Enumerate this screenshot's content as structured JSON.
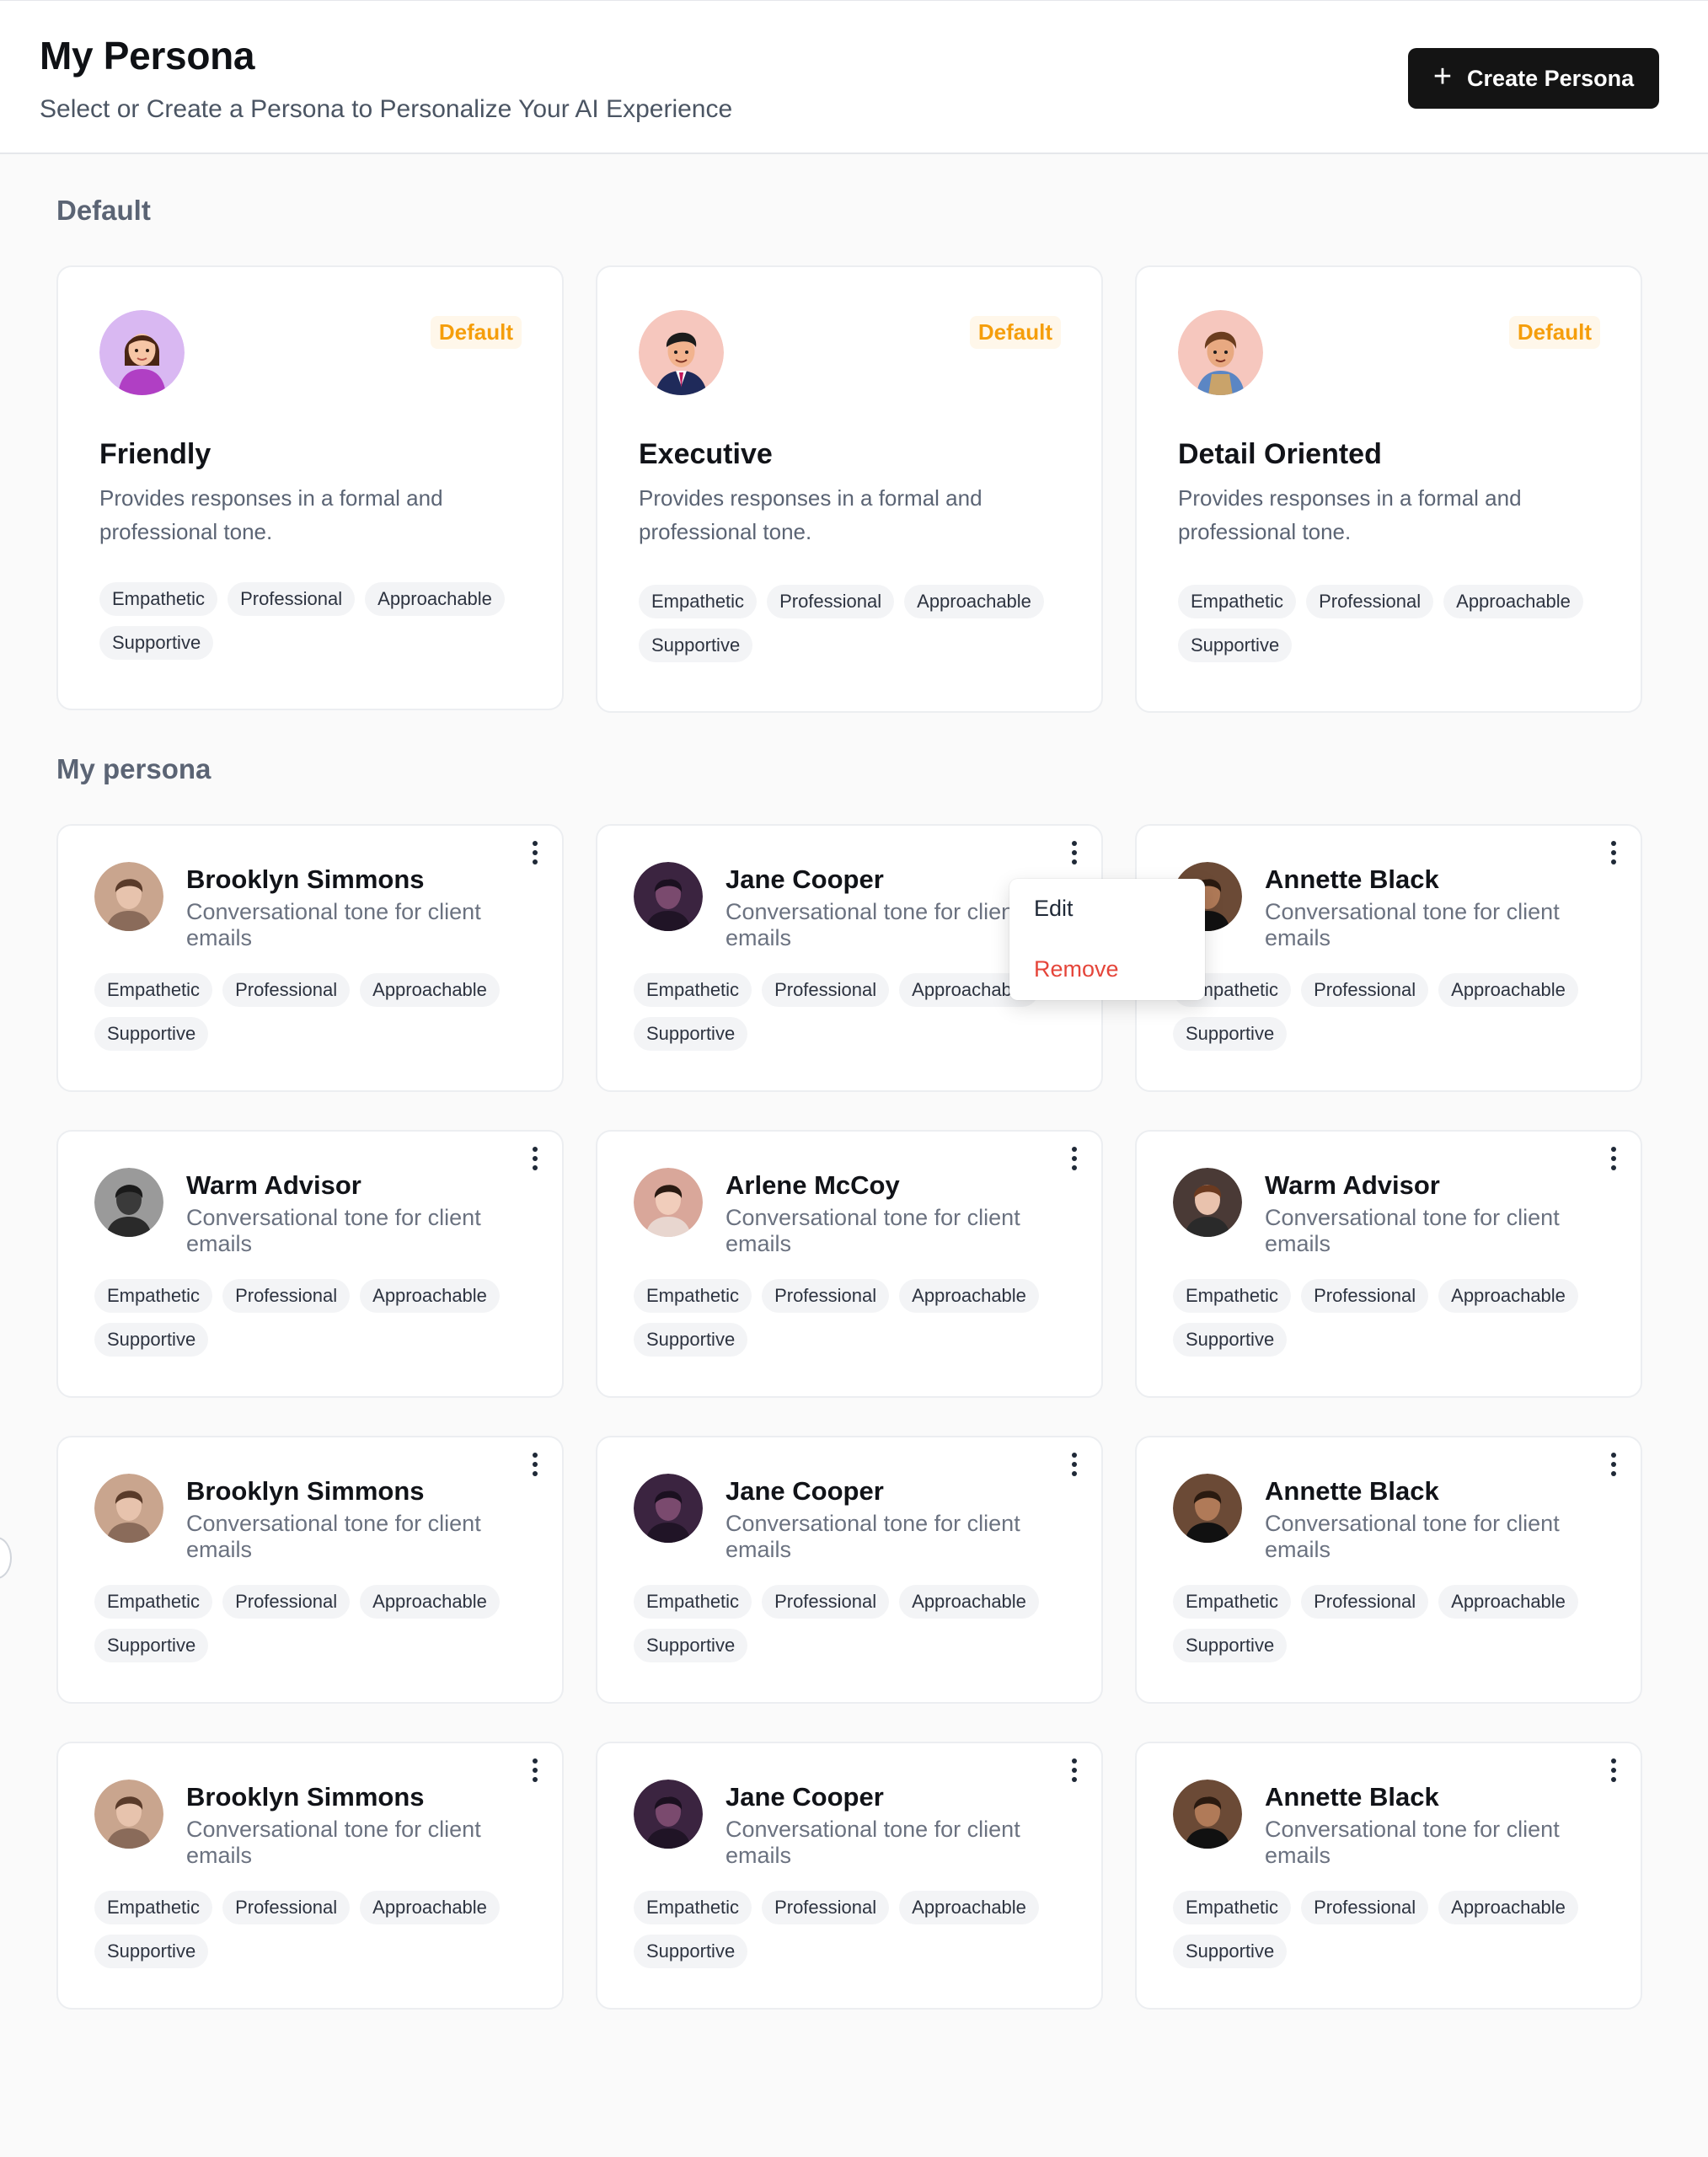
{
  "header": {
    "title": "My Persona",
    "subtitle": "Select or Create a Persona to Personalize Your AI Experience",
    "create_button_label": "Create Persona",
    "create_button_icon": "plus-icon"
  },
  "sections": {
    "default_label": "Default",
    "my_persona_label": "My persona"
  },
  "default_personas": [
    {
      "name": "Friendly",
      "badge": "Default",
      "description": "Provides responses in a formal and professional tone.",
      "tags": [
        "Empathetic",
        "Professional",
        "Approachable",
        "Supportive"
      ],
      "avatar": "woman-avatar-icon"
    },
    {
      "name": "Executive",
      "badge": "Default",
      "description": "Provides responses in a formal and professional tone.",
      "tags": [
        "Empathetic",
        "Professional",
        "Approachable",
        "Supportive"
      ],
      "avatar": "businessman-avatar-icon"
    },
    {
      "name": "Detail Oriented",
      "badge": "Default",
      "description": "Provides responses in a formal and professional tone.",
      "tags": [
        "Empathetic",
        "Professional",
        "Approachable",
        "Supportive"
      ],
      "avatar": "boy-avatar-icon"
    }
  ],
  "my_personas": [
    {
      "name": "Brooklyn Simmons",
      "description": "Conversational tone for client emails",
      "tags": [
        "Empathetic",
        "Professional",
        "Approachable",
        "Supportive"
      ]
    },
    {
      "name": "Jane Cooper",
      "description": "Conversational tone for client emails",
      "tags": [
        "Empathetic",
        "Professional",
        "Approachable",
        "Supportive"
      ]
    },
    {
      "name": "Annette Black",
      "description": "Conversational tone for client emails",
      "tags": [
        "Empathetic",
        "Professional",
        "Approachable",
        "Supportive"
      ]
    },
    {
      "name": "Warm Advisor",
      "description": "Conversational tone for client emails",
      "tags": [
        "Empathetic",
        "Professional",
        "Approachable",
        "Supportive"
      ]
    },
    {
      "name": "Arlene McCoy",
      "description": "Conversational tone for client emails",
      "tags": [
        "Empathetic",
        "Professional",
        "Approachable",
        "Supportive"
      ]
    },
    {
      "name": "Warm Advisor",
      "description": "Conversational tone for client emails",
      "tags": [
        "Empathetic",
        "Professional",
        "Approachable",
        "Supportive"
      ]
    },
    {
      "name": "Brooklyn Simmons",
      "description": "Conversational tone for client emails",
      "tags": [
        "Empathetic",
        "Professional",
        "Approachable",
        "Supportive"
      ]
    },
    {
      "name": "Jane Cooper",
      "description": "Conversational tone for client emails",
      "tags": [
        "Empathetic",
        "Professional",
        "Approachable",
        "Supportive"
      ]
    },
    {
      "name": "Annette Black",
      "description": "Conversational tone for client emails",
      "tags": [
        "Empathetic",
        "Professional",
        "Approachable",
        "Supportive"
      ]
    },
    {
      "name": "Brooklyn Simmons",
      "description": "Conversational tone for client emails",
      "tags": [
        "Empathetic",
        "Professional",
        "Approachable",
        "Supportive"
      ]
    },
    {
      "name": "Jane Cooper",
      "description": "Conversational tone for client emails",
      "tags": [
        "Empathetic",
        "Professional",
        "Approachable",
        "Supportive"
      ]
    },
    {
      "name": "Annette Black",
      "description": "Conversational tone for client emails",
      "tags": [
        "Empathetic",
        "Professional",
        "Approachable",
        "Supportive"
      ]
    }
  ],
  "context_menu": {
    "edit_label": "Edit",
    "remove_label": "Remove"
  },
  "colors": {
    "primary_button": "#141414",
    "default_badge_text": "#f59e0b",
    "default_badge_bg": "#fff7ea",
    "remove_text": "#e5453a",
    "section_label": "#5b6474"
  }
}
